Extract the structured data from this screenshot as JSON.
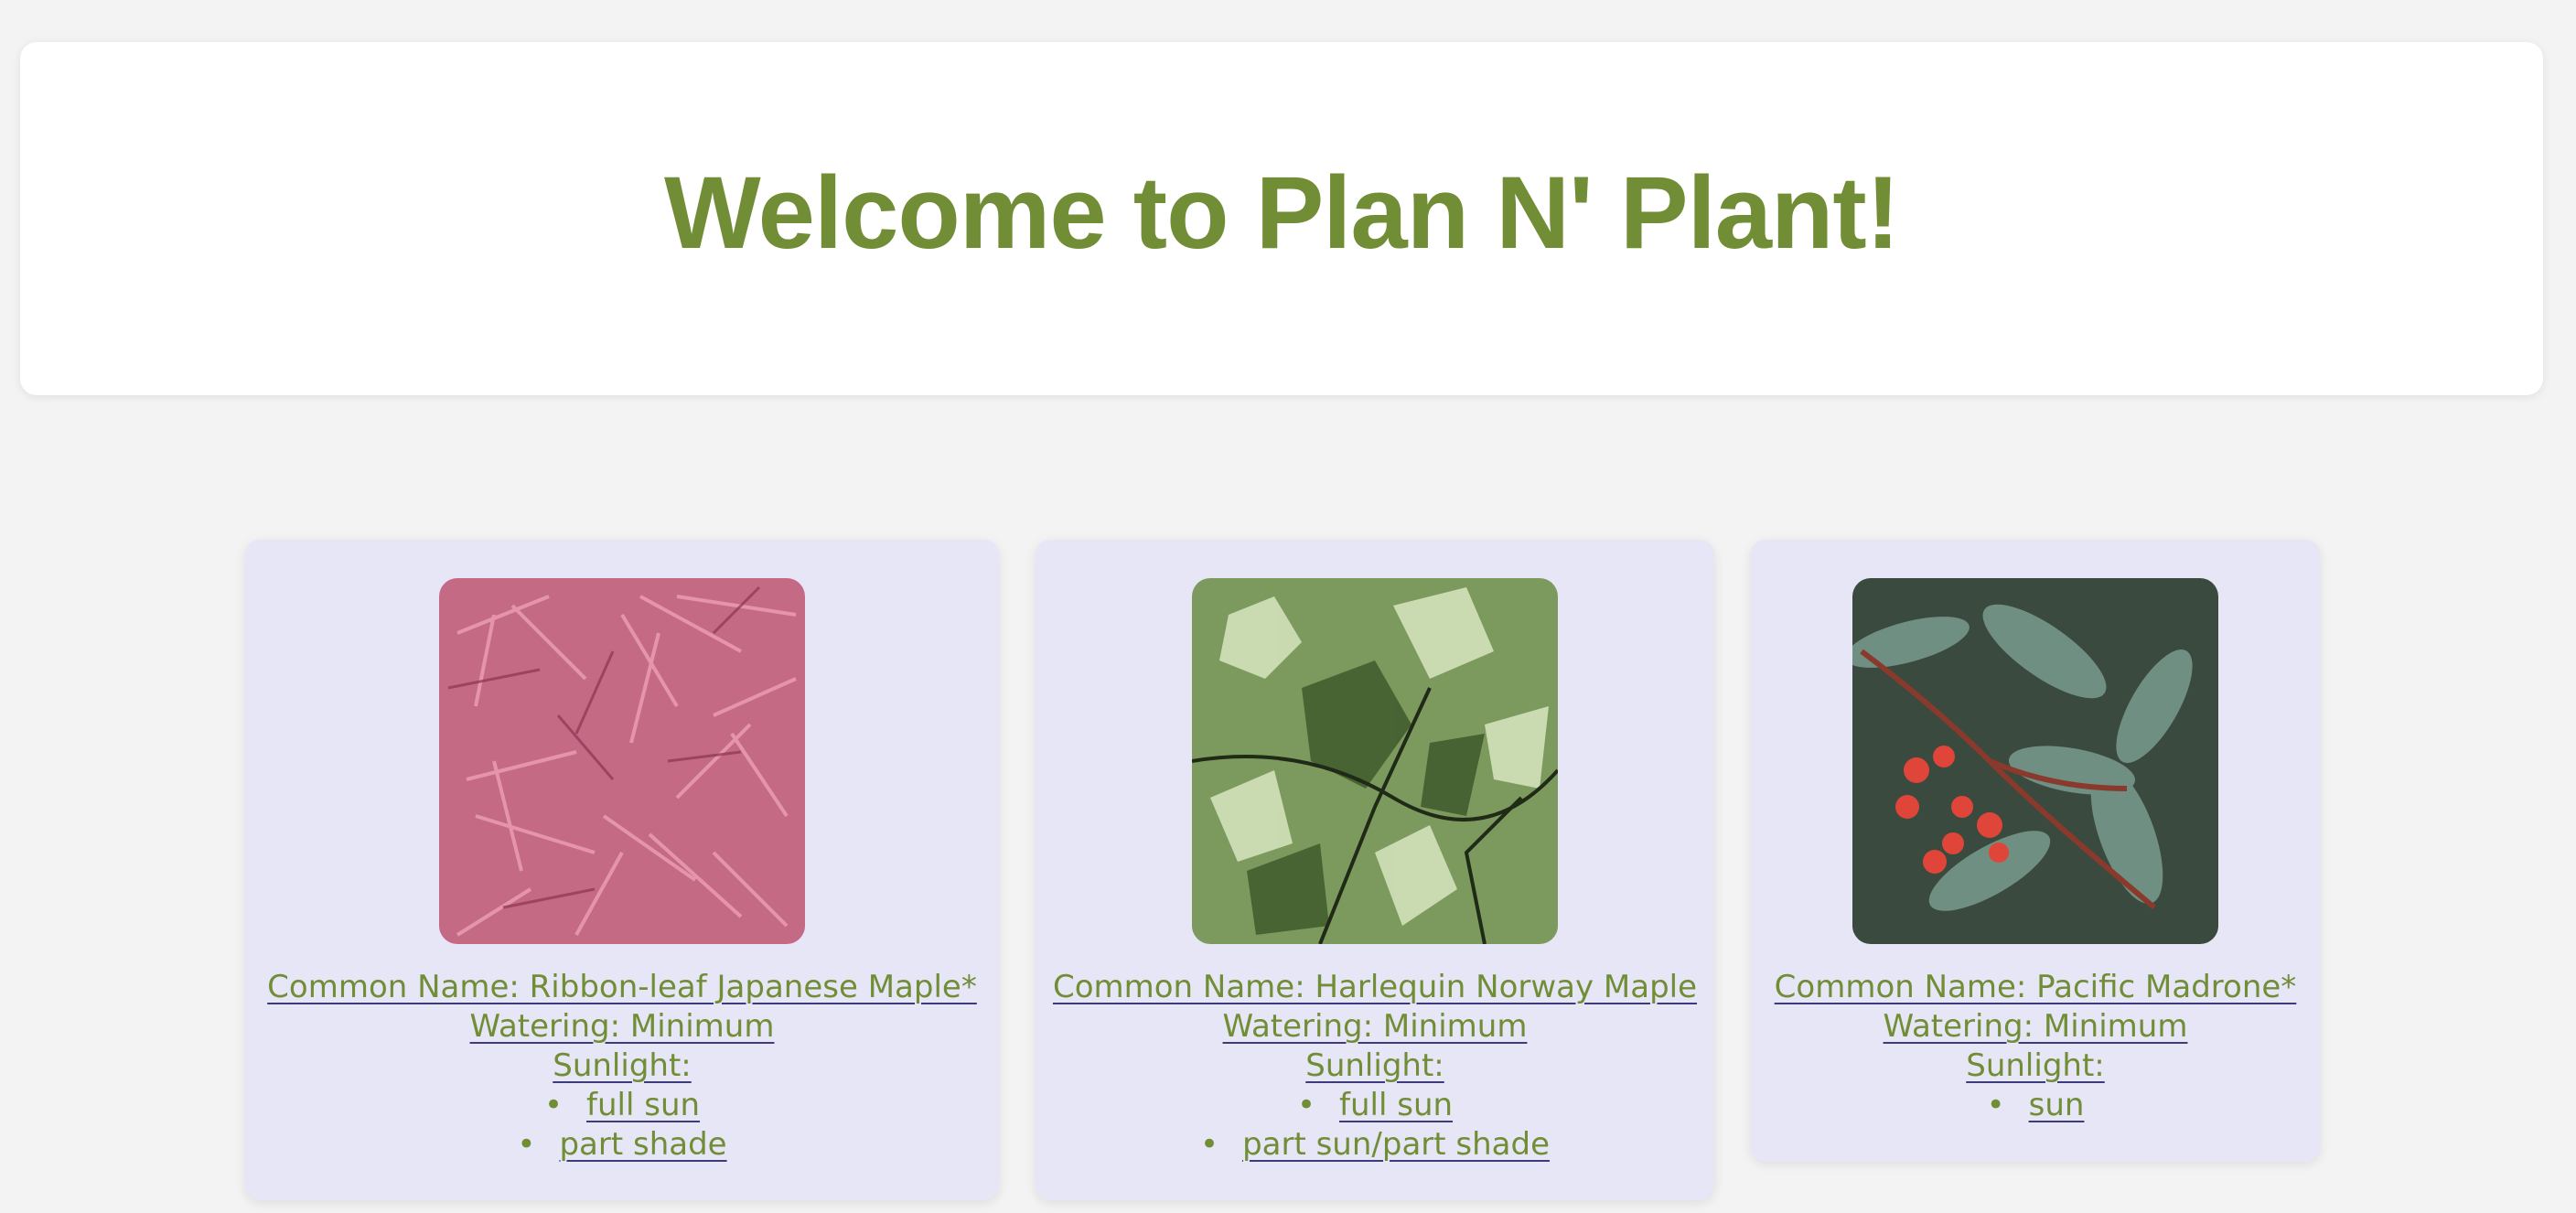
{
  "header": {
    "title": "Welcome to Plan N' Plant!"
  },
  "colors": {
    "accent_green": "#718d36",
    "card_bg": "#e6e6f7",
    "page_bg": "#f3f3f3"
  },
  "plants": [
    {
      "common_name": "Common Name: Ribbon-leaf Japanese Maple*",
      "watering": "Watering: Minimum",
      "sunlight_label": "Sunlight:",
      "sunlight": [
        "full sun",
        "part shade"
      ]
    },
    {
      "common_name": "Common Name: Harlequin Norway Maple",
      "watering": "Watering: Minimum",
      "sunlight_label": "Sunlight:",
      "sunlight": [
        "full sun",
        "part sun/part shade"
      ]
    },
    {
      "common_name": "Common Name: Pacific Madrone*",
      "watering": "Watering: Minimum",
      "sunlight_label": "Sunlight:",
      "sunlight": [
        "sun"
      ]
    }
  ]
}
